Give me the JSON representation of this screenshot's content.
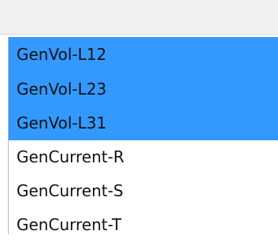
{
  "listbox": {
    "items": [
      {
        "label": "GenVol-L12",
        "selected": true
      },
      {
        "label": "GenVol-L23",
        "selected": true
      },
      {
        "label": "GenVol-L31",
        "selected": true
      },
      {
        "label": "GenCurrent-R",
        "selected": false
      },
      {
        "label": "GenCurrent-S",
        "selected": false
      },
      {
        "label": "GenCurrent-T",
        "selected": false
      }
    ]
  },
  "colors": {
    "selection": "#3399ff",
    "background": "#ffffff",
    "top_bar": "#f0f0f0",
    "text": "#111111"
  }
}
